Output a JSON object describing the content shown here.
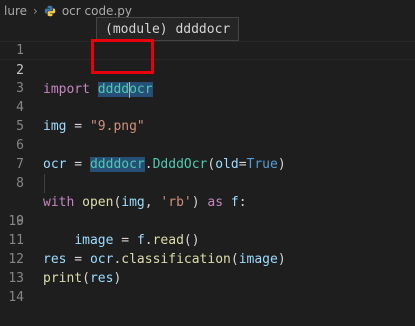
{
  "breadcrumb": {
    "folder": "lure",
    "file": "ocr code.py"
  },
  "tooltip": "(module) ddddocr",
  "colors": {
    "red_box": "#e8000b",
    "background": "#1e1e1e"
  },
  "lines": [
    {
      "num": "1"
    },
    {
      "num": "2",
      "tokens": [
        "import",
        " ",
        "dddd",
        "ocr"
      ]
    },
    {
      "num": "3"
    },
    {
      "num": "4",
      "tokens": [
        "img",
        " = ",
        "\"9.png\""
      ]
    },
    {
      "num": "5"
    },
    {
      "num": "6",
      "tokens": [
        "ocr",
        " = ",
        "ddddocr",
        ".",
        "DdddOcr",
        "(",
        "old",
        "=",
        "True",
        ")"
      ]
    },
    {
      "num": "7"
    },
    {
      "num": "8",
      "tokens": [
        "with",
        " ",
        "open",
        "(",
        "img",
        ", ",
        "'rb'",
        ") ",
        "as",
        " ",
        "f",
        ":"
      ]
    },
    {
      "num": "9",
      "tokens": [
        "    ",
        "image",
        " = ",
        "f",
        ".",
        "read",
        "()"
      ]
    },
    {
      "num": "10"
    },
    {
      "num": "11",
      "tokens": [
        "res",
        " = ",
        "ocr",
        ".",
        "classification",
        "(",
        "image",
        ")"
      ]
    },
    {
      "num": "12",
      "tokens": [
        "print",
        "(",
        "res",
        ")"
      ]
    },
    {
      "num": "13"
    },
    {
      "num": "14"
    }
  ]
}
